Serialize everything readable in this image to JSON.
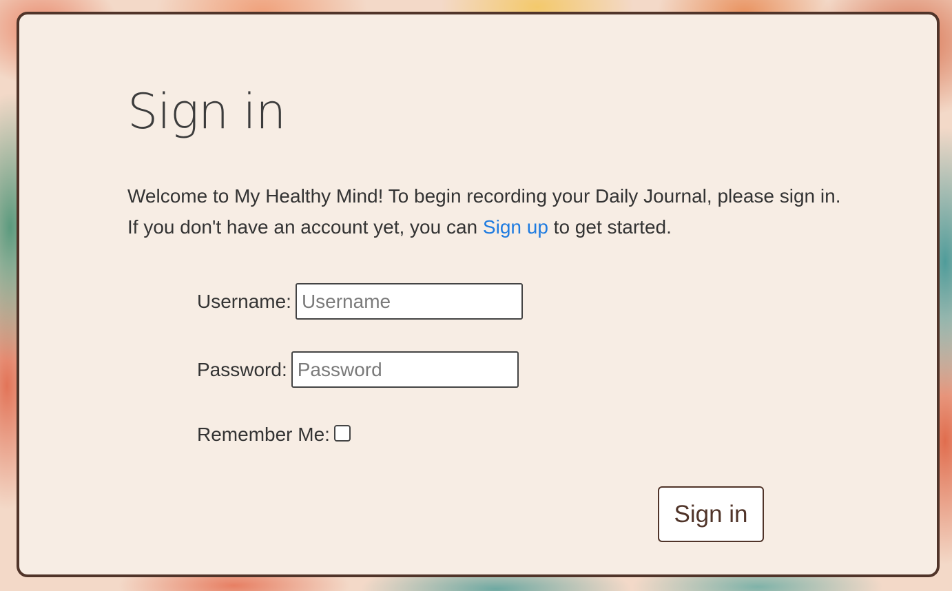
{
  "page": {
    "title": "Sign in",
    "intro_line1": "Welcome to My Healthy Mind! To begin recording your Daily Journal, please sign in.",
    "intro_line2_prefix": "If you don't have an account yet, you can",
    "signup_link": "Sign up",
    "intro_line2_suffix": "to get started."
  },
  "form": {
    "username_label": "Username:",
    "username_placeholder": "Username",
    "username_value": "",
    "password_label": "Password:",
    "password_placeholder": "Password",
    "password_value": "",
    "remember_label": "Remember Me:",
    "remember_checked": false,
    "submit_label": "Sign in"
  },
  "colors": {
    "card_background": "#f7ede4",
    "card_border": "#503429",
    "link": "#1e7be0",
    "button_text": "#503429"
  }
}
